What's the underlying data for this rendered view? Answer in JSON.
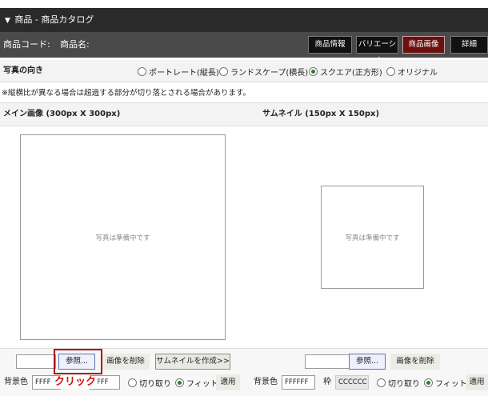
{
  "header": {
    "title": "商品 - 商品カタログ"
  },
  "info": {
    "code_label": "商品コード:",
    "name_label": "商品名:"
  },
  "tabs": [
    {
      "label": "商品情報",
      "active": false
    },
    {
      "label": "バリエーション",
      "active": false
    },
    {
      "label": "商品画像",
      "active": true
    },
    {
      "label": "詳細",
      "active": false
    }
  ],
  "orientation": {
    "label": "写真の向き",
    "options": [
      {
        "label": "ポートレート(縦長)",
        "selected": false
      },
      {
        "label": "ランドスケープ(横長)",
        "selected": false
      },
      {
        "label": "スクエア(正方形)",
        "selected": true
      },
      {
        "label": "オリジナル",
        "selected": false
      }
    ]
  },
  "notice": "※縦横比が異なる場合は超過する部分が切り落とされる場合があります。",
  "main_image": {
    "heading": "メイン画像 (300px X 300px)",
    "placeholder": "写真は準備中です",
    "browse_label": "参照...",
    "delete_label": "画像を削除",
    "make_thumb_label": "サムネイルを作成>>",
    "bg_label": "背景色",
    "bg_value": "FFFF",
    "frame_value": "FFFF",
    "crop_label": "切り取り",
    "fit_label": "フィット",
    "fit_selected": true,
    "apply_label": "適用"
  },
  "thumbnail": {
    "heading": "サムネイル (150px X 150px)",
    "placeholder": "写真は準備中です",
    "browse_label": "参照...",
    "delete_label": "画像を削除",
    "bg_label": "背景色",
    "bg_value": "FFFFFF",
    "frame_label": "枠",
    "frame_value": "CCCCCC",
    "crop_label": "切り取り",
    "fit_label": "フィット",
    "fit_selected": true,
    "apply_label": "適用"
  },
  "annotation": {
    "text": "クリック"
  },
  "colors": {
    "active_tab": "#6b1010",
    "highlight": "#b01010",
    "title_bar": "#2a2a2a"
  }
}
